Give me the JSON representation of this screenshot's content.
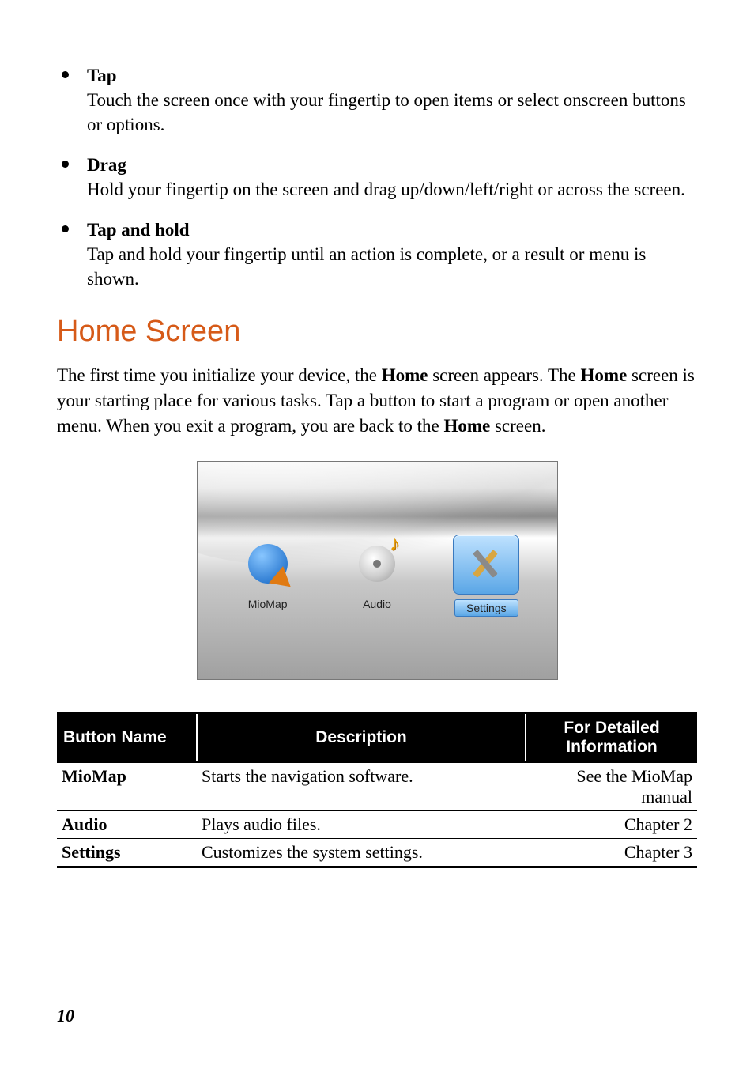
{
  "gestures": [
    {
      "title": "Tap",
      "desc": "Touch the screen once with your fingertip to open items or select onscreen buttons or options."
    },
    {
      "title": "Drag",
      "desc": "Hold your fingertip on the screen and drag up/down/left/right or across the screen."
    },
    {
      "title": "Tap and hold",
      "desc": "Tap and hold your fingertip until an action is complete, or a result or menu is shown."
    }
  ],
  "section_heading": "Home Screen",
  "intro": {
    "p1a": "The first time you initialize your device, the ",
    "home1": "Home",
    "p1b": " screen appears. The ",
    "home2": "Home",
    "p1c": " screen is your starting place for various tasks. Tap a button to start a program or open another menu. When you exit a program, you are back to the ",
    "home3": "Home",
    "p1d": " screen."
  },
  "screenshot_apps": {
    "miomap": "MioMap",
    "audio": "Audio",
    "settings": "Settings"
  },
  "table": {
    "headers": {
      "name": "Button Name",
      "desc": "Description",
      "info_l1": "For Detailed",
      "info_l2": "Information"
    },
    "rows": [
      {
        "name": "MioMap",
        "desc": "Starts the navigation software.",
        "info": "See the MioMap manual"
      },
      {
        "name": "Audio",
        "desc": "Plays audio files.",
        "info": "Chapter 2"
      },
      {
        "name": "Settings",
        "desc": "Customizes the system settings.",
        "info": "Chapter 3"
      }
    ]
  },
  "page_number": "10"
}
